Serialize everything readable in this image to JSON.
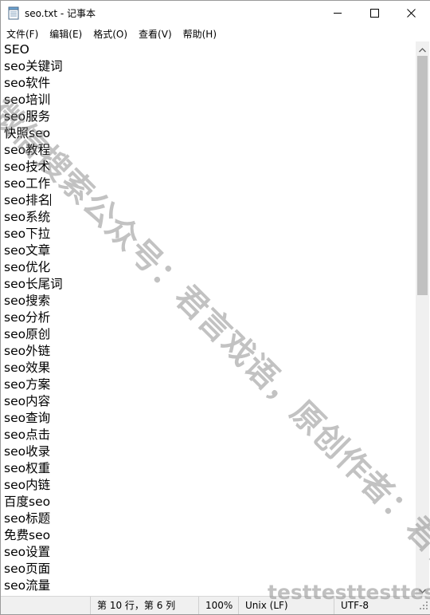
{
  "window": {
    "title": "seo.txt - 记事本",
    "app_icon": "notepad-icon",
    "controls": {
      "minimize_icon": "minimize-icon",
      "maximize_icon": "maximize-icon",
      "close_icon": "close-icon"
    }
  },
  "menu": {
    "items": [
      "文件(F)",
      "编辑(E)",
      "格式(O)",
      "查看(V)",
      "帮助(H)"
    ]
  },
  "editor": {
    "lines": [
      "SEO",
      "seo关键词",
      "seo软件",
      "seo培训",
      "seo服务",
      "快照seo",
      "seo教程",
      "seo技术",
      "seo工作",
      "seo排名",
      "seo系统",
      "seo下拉",
      "seo文章",
      "seo优化",
      "seo长尾词",
      "seo搜索",
      "seo分析",
      "seo原创",
      "seo外链",
      "seo效果",
      "seo方案",
      "seo内容",
      "seo查询",
      "seo点击",
      "seo收录",
      "seo权重",
      "seo内链",
      "百度seo",
      "seo标题",
      "免费seo",
      "seo设置",
      "seo页面",
      "seo流量"
    ],
    "caret_line": 10,
    "scroll_fraction": 0.0
  },
  "statusbar": {
    "position": "第 10 行，第 6 列",
    "zoom": "100%",
    "line_ending": "Unix (LF)",
    "encoding": "UTF-8"
  },
  "watermarks": {
    "diagonal": "微信搜索公众号：君言戏语，原创作者：君言",
    "bottom": "testtesttesttest"
  }
}
